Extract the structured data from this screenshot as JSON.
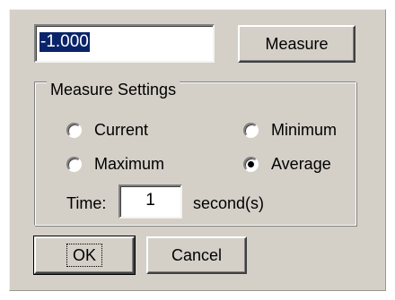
{
  "measure": {
    "value": "-1.000",
    "button_label": "Measure"
  },
  "settings": {
    "group_title": "Measure Settings",
    "options": [
      {
        "label": "Current",
        "checked": false
      },
      {
        "label": "Minimum",
        "checked": false
      },
      {
        "label": "Maximum",
        "checked": false
      },
      {
        "label": "Average",
        "checked": true
      }
    ],
    "time_label": "Time:",
    "time_value": "1",
    "time_unit": "second(s)"
  },
  "footer": {
    "ok_label": "OK",
    "cancel_label": "Cancel"
  },
  "colors": {
    "dialog_background": "#d4d0c8",
    "selection_background": "#0a246a"
  }
}
